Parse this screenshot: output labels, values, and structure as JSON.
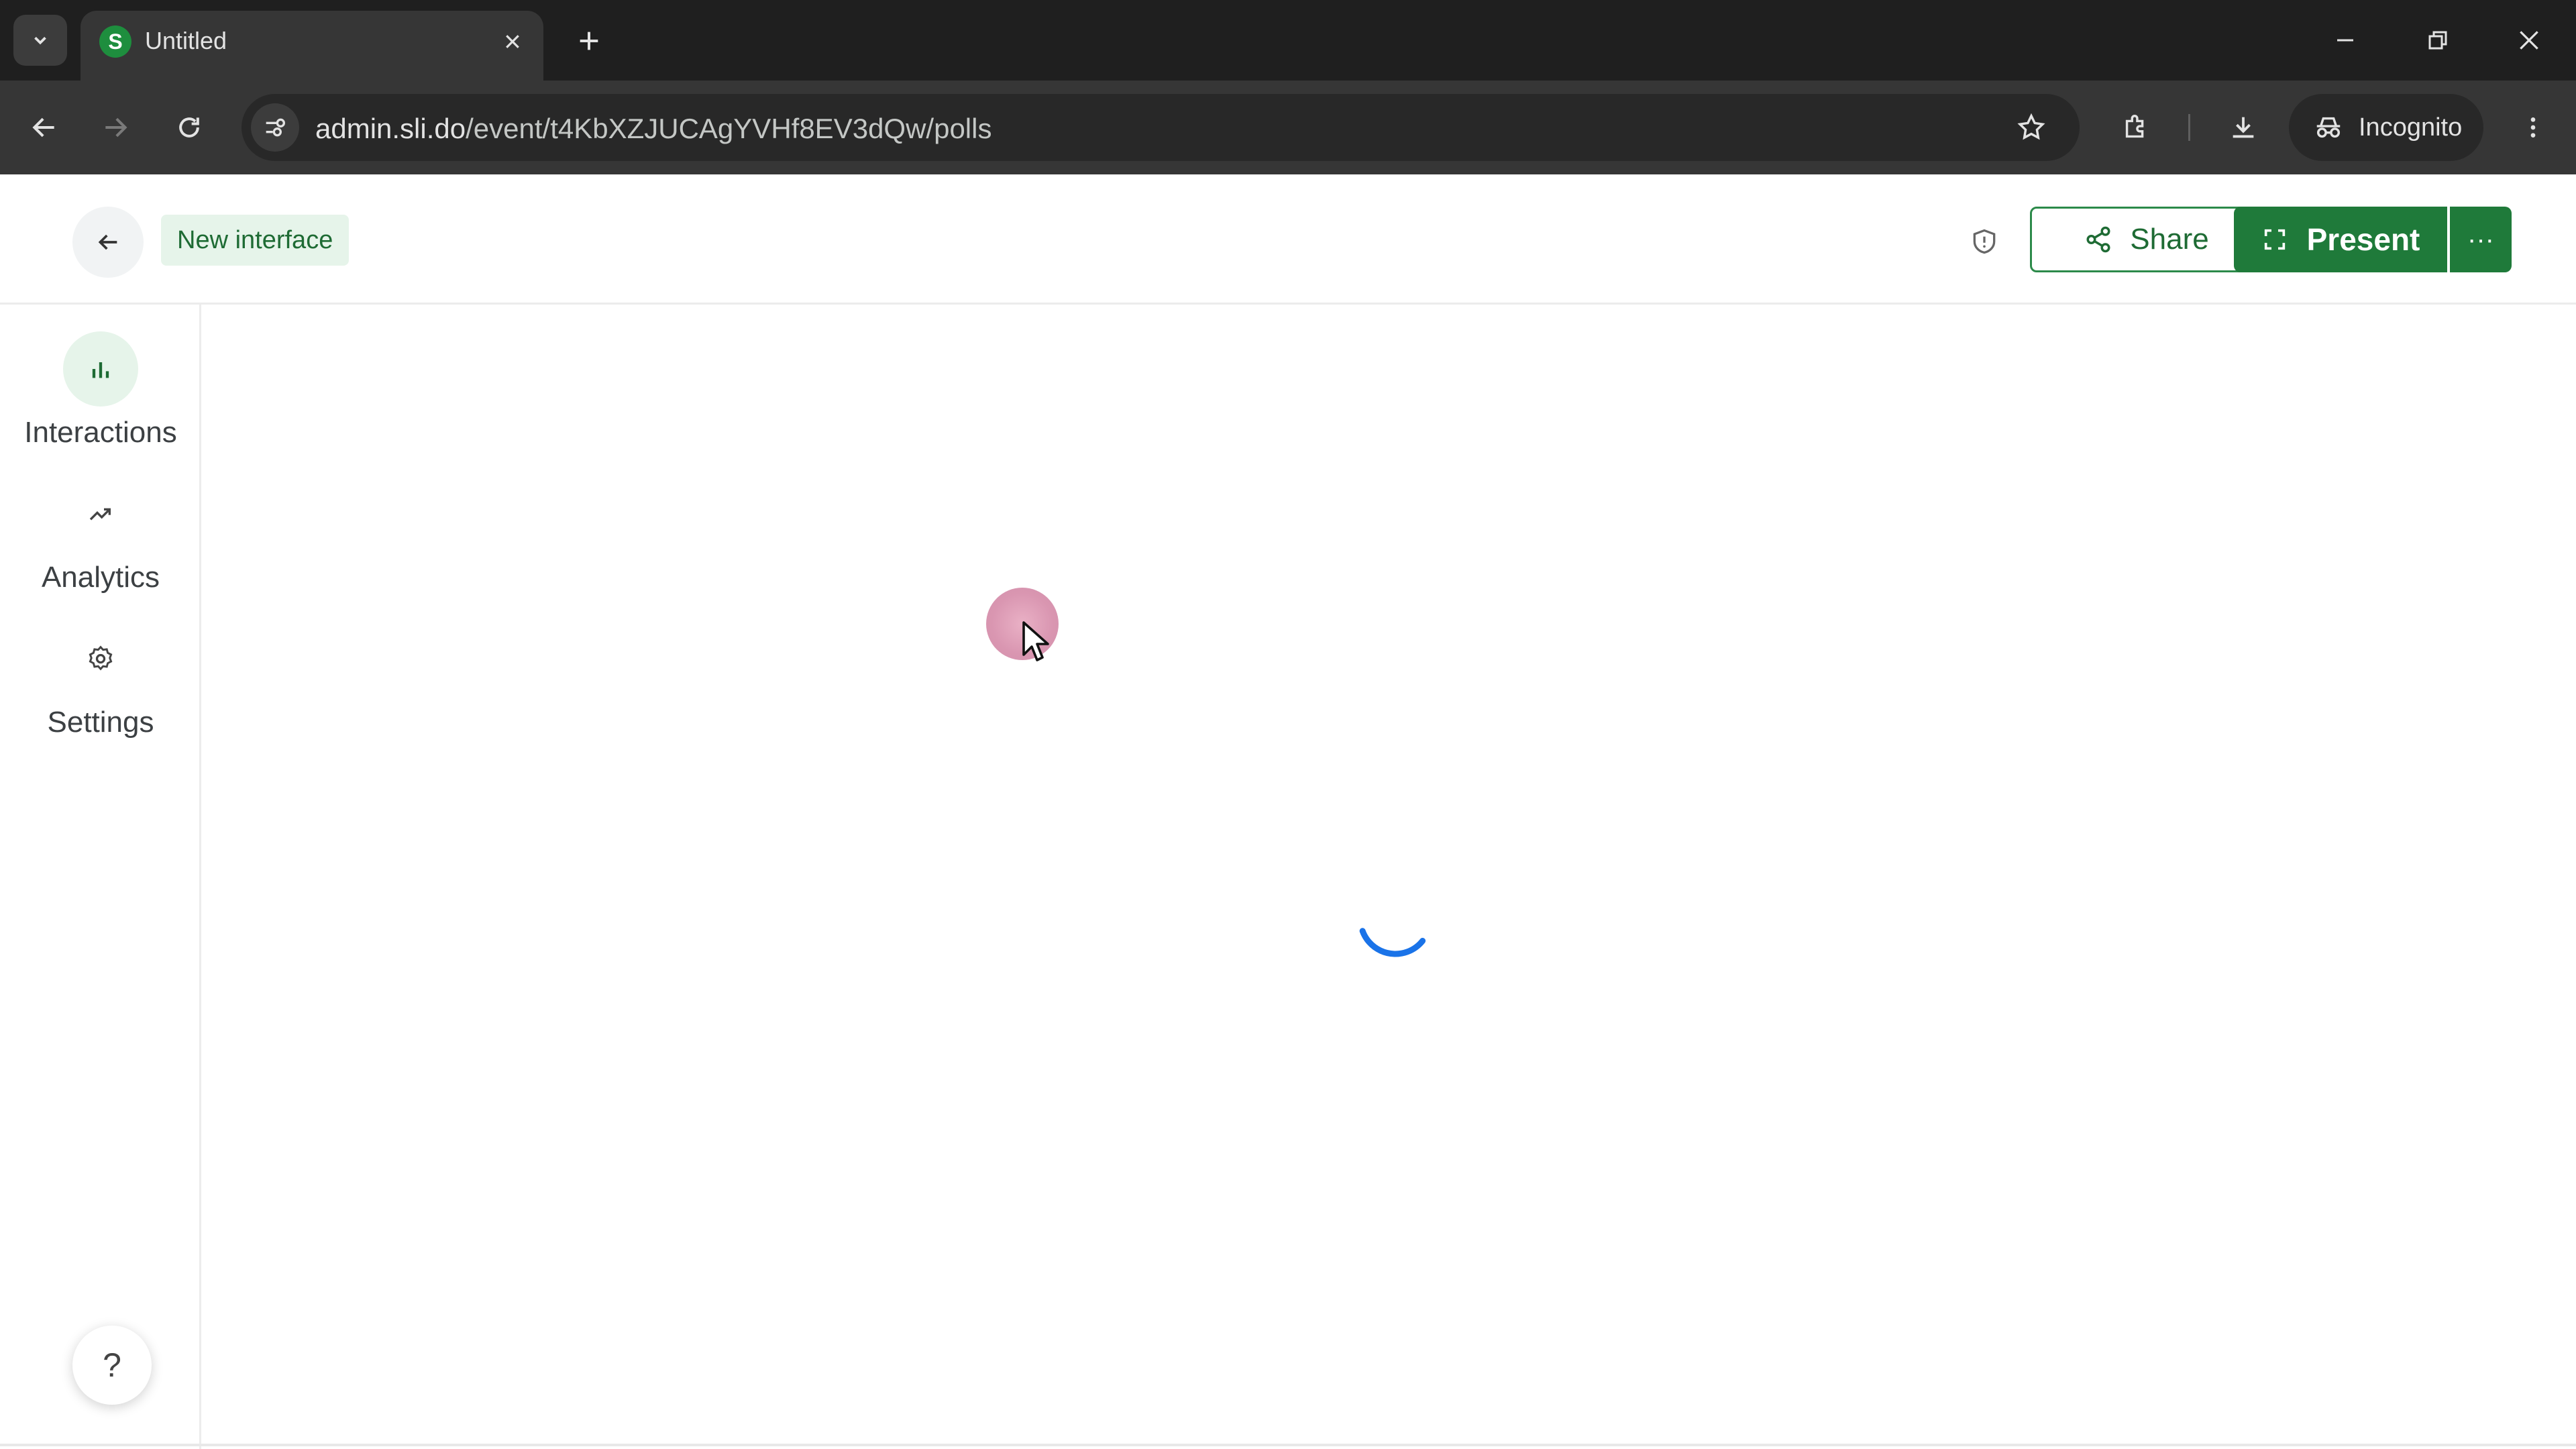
{
  "browser": {
    "tab_title": "Untitled",
    "tab_favicon_letter": "S",
    "url_host": "admin.sli.do",
    "url_path": "/event/t4KbXZJUCAgYVHf8EV3dQw/polls",
    "profile_label": "Incognito",
    "icons": [
      "tab-search-icon",
      "close-icon",
      "plus-icon",
      "minimize-icon",
      "restore-icon",
      "window-close-icon",
      "back-arrow-icon",
      "forward-arrow-icon",
      "reload-icon",
      "site-settings-icon",
      "star-icon",
      "extensions-icon",
      "download-icon",
      "incognito-icon",
      "more-vert-icon"
    ]
  },
  "header": {
    "badge_label": "New interface",
    "share_label": "Share",
    "present_label": "Present",
    "more_label": "···"
  },
  "sidebar": {
    "items": [
      {
        "label": "Interactions",
        "icon": "bar-chart-icon",
        "active": true
      },
      {
        "label": "Analytics",
        "icon": "trend-icon",
        "active": false
      },
      {
        "label": "Settings",
        "icon": "gear-icon",
        "active": false
      }
    ],
    "help_label": "?"
  },
  "main": {
    "state": "loading"
  },
  "colors": {
    "brand_green": "#1f7a3a",
    "badge_bg": "#e6f4ea",
    "spinner_blue": "#1a73e8"
  }
}
